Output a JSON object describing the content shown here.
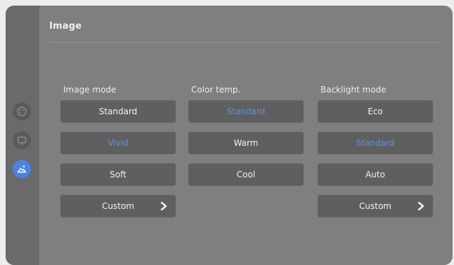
{
  "page": {
    "title": "Image"
  },
  "sidebar": {
    "items": [
      {
        "icon": "palette-icon",
        "active": false
      },
      {
        "icon": "screen-icon",
        "active": false
      },
      {
        "icon": "picture-icon",
        "active": true
      }
    ]
  },
  "columns": [
    {
      "label": "Image mode",
      "options": [
        {
          "label": "Standard",
          "selected": false
        },
        {
          "label": "Vivid",
          "selected": true
        },
        {
          "label": "Soft",
          "selected": false
        },
        {
          "label": "Custom",
          "selected": false,
          "has_chevron": true
        }
      ]
    },
    {
      "label": "Color temp.",
      "options": [
        {
          "label": "Standard",
          "selected": true
        },
        {
          "label": "Warm",
          "selected": false
        },
        {
          "label": "Cool",
          "selected": false
        }
      ]
    },
    {
      "label": "Backlight mode",
      "options": [
        {
          "label": "Eco",
          "selected": false
        },
        {
          "label": "Standard",
          "selected": true
        },
        {
          "label": "Auto",
          "selected": false
        },
        {
          "label": "Custom",
          "selected": false,
          "has_chevron": true
        }
      ]
    }
  ],
  "colors": {
    "accent": "#4b82e6",
    "selected_text": "#5a8ff0",
    "panel": "#7f7f7f",
    "button": "#5f5f5f"
  }
}
